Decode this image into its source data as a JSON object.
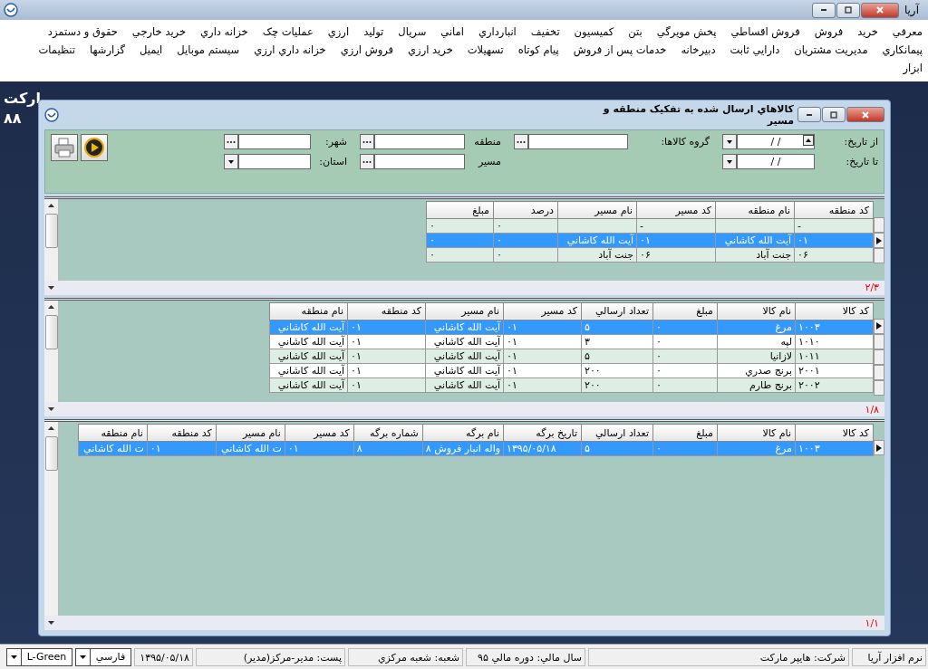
{
  "app_window": {
    "title": "آريا"
  },
  "menu": {
    "items": [
      "معرفي",
      "خريد",
      "فروش",
      "فروش اقساطي",
      "پخش مويرگي",
      "بتن",
      "كميسيون",
      "تخفيف",
      "انبارداري",
      "اماني",
      "سريال",
      "توليد",
      "ارزي",
      "عمليات چک",
      "خزانه داري",
      "خريد خارجي",
      "حقوق و دستمزد",
      "پيمانكاري",
      "مديريت مشتريان",
      "دارايي ثابت",
      "دبيرخانه",
      "خدمات پس از فروش",
      "پيام کوتاه",
      "تسهيلات",
      "خريد ارزي",
      "فروش ارزي",
      "خزانه داري ارزي",
      "سيستم موبايل",
      "ايميل",
      "گزارشها",
      "تنظيمات",
      "ابزار"
    ]
  },
  "background_text": [
    "ارکت",
    "۸۸"
  ],
  "report_window": {
    "title": "کالاهاي ارسال شده به تفکيک منطقه و مسير"
  },
  "filters": [
    [
      {
        "label": "از تاريخ:",
        "kind": "date",
        "value": "/  /",
        "spinner": true
      },
      {
        "label": "تا تاريخ:",
        "kind": "date",
        "value": "/  /",
        "spinner": false
      }
    ],
    [
      {
        "label": "گروه کالاها:",
        "kind": "lookup"
      }
    ],
    [
      {
        "label": "منطقه",
        "kind": "lookup"
      },
      {
        "label": "مسير",
        "kind": "lookup"
      }
    ],
    [
      {
        "label": "شهر:",
        "kind": "lookup"
      },
      {
        "label": "استان:",
        "kind": "combo"
      }
    ]
  ],
  "grids": [
    {
      "columns": [
        "کد منطقه",
        "نام منطقه",
        "کد مسير",
        "نام مسير",
        "درصد",
        "مبلغ"
      ],
      "rows": [
        {
          "cells": [
            "-",
            null,
            "-",
            null,
            "۰",
            "۰"
          ],
          "selected": false,
          "current": false
        },
        {
          "cells": [
            "۰۱",
            "آيت الله کاشاني",
            "۰۱",
            "آيت الله کاشاني",
            "۰",
            "۰"
          ],
          "selected": true,
          "current": true
        },
        {
          "cells": [
            "۰۶",
            "جنت آباد",
            "۰۶",
            "جنت آباد",
            "۰",
            "۰"
          ],
          "selected": false,
          "current": false
        }
      ],
      "pager": "۲/۳"
    },
    {
      "columns": [
        "کد کالا",
        "نام کالا",
        "مبلغ",
        "تعداد ارسالي",
        "کد مسير",
        "نام مسير",
        "کد منطقه",
        "نام منطقه"
      ],
      "rows": [
        {
          "cells": [
            "۱۰۰۳",
            "مرغ",
            "۰",
            "۵",
            "۰۱",
            "آيت الله کاشاني",
            "۰۱",
            "آيت الله کاشاني"
          ],
          "selected": true,
          "current": true
        },
        {
          "cells": [
            "۱۰۱۰",
            "لپه",
            "۰",
            "۳",
            "۰۱",
            "آيت الله کاشاني",
            "۰۱",
            "آيت الله کاشاني"
          ],
          "selected": false,
          "current": false
        },
        {
          "cells": [
            "۱۰۱۱",
            "لازانيا",
            "۰",
            "۵",
            "۰۱",
            "آيت الله کاشاني",
            "۰۱",
            "آيت الله کاشاني"
          ],
          "selected": false,
          "current": false
        },
        {
          "cells": [
            "۲۰۰۱",
            "برنج صدري",
            "۰",
            "۲۰۰",
            "۰۱",
            "آيت الله کاشاني",
            "۰۱",
            "آيت الله کاشاني"
          ],
          "selected": false,
          "current": false
        },
        {
          "cells": [
            "۲۰۰۲",
            "برنج طارم",
            "۰",
            "۲۰۰",
            "۰۱",
            "آيت الله کاشاني",
            "۰۱",
            "آيت الله کاشاني"
          ],
          "selected": false,
          "current": false
        }
      ],
      "pager": "۱/۸"
    },
    {
      "columns": [
        "کد کالا",
        "نام کالا",
        "مبلغ",
        "تعداد ارسالي",
        "تاريخ برگه",
        "نام برگه",
        "شماره برگه",
        "کد مسير",
        "نام مسير",
        "کد منطقه",
        "نام منطقه"
      ],
      "rows": [
        {
          "cells": [
            "۱۰۰۳",
            "مرغ",
            "۰",
            "۵",
            "۱۳۹۵/۰۵/۱۸",
            "واله انبار فروش ۸",
            "۸",
            "۰۱",
            "ت الله کاشاني",
            "۰۱",
            "ت الله کاشاني"
          ],
          "selected": true,
          "current": true
        }
      ],
      "pager": "۱/۱"
    }
  ],
  "status_bar": {
    "cells": [
      "نرم افزار آريا",
      "شرکت: هايپر مارکت",
      "سال مالي: دوره مالي ۹۵",
      "شعبه: شعبه مرکزي",
      "پست: مدير-مرکز(مدير)",
      "۱۳۹۵/۰۵/۱۸"
    ],
    "language": "فارسي",
    "theme": "L-Green"
  }
}
